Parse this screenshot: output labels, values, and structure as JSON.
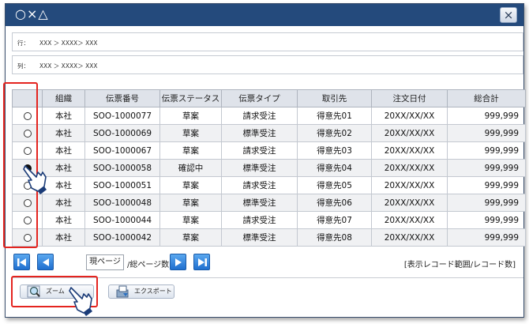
{
  "window": {
    "title": "○×△",
    "close_label": "×"
  },
  "breadcrumb_rows": [
    {
      "label": "行：",
      "path": "XXX ＞ XXXX＞ XXX"
    },
    {
      "label": "列：",
      "path": "XXX ＞ XXXX＞ XXX"
    }
  ],
  "table": {
    "columns": [
      "",
      "組織",
      "伝票番号",
      "伝票ステータス",
      "伝票タイプ",
      "取引先",
      "注文日付",
      "総合計"
    ],
    "rows": [
      {
        "selected": false,
        "org": "本社",
        "slip_no": "SOO-1000077",
        "status": "草案",
        "type": "請求受注",
        "partner": "得意先01",
        "date": "20XX/XX/XX",
        "total": "999,999"
      },
      {
        "selected": false,
        "org": "本社",
        "slip_no": "SOO-1000069",
        "status": "草案",
        "type": "標準受注",
        "partner": "得意先02",
        "date": "20XX/XX/XX",
        "total": "999,999"
      },
      {
        "selected": false,
        "org": "本社",
        "slip_no": "SOO-1000067",
        "status": "草案",
        "type": "請求受注",
        "partner": "得意先03",
        "date": "20XX/XX/XX",
        "total": "999,999"
      },
      {
        "selected": true,
        "org": "本社",
        "slip_no": "SOO-1000058",
        "status": "確認中",
        "type": "標準受注",
        "partner": "得意先04",
        "date": "20XX/XX/XX",
        "total": "999,999"
      },
      {
        "selected": false,
        "org": "本社",
        "slip_no": "SOO-1000051",
        "status": "草案",
        "type": "請求受注",
        "partner": "得意先05",
        "date": "20XX/XX/XX",
        "total": "999,999"
      },
      {
        "selected": false,
        "org": "本社",
        "slip_no": "SOO-1000048",
        "status": "草案",
        "type": "標準受注",
        "partner": "得意先06",
        "date": "20XX/XX/XX",
        "total": "999,999"
      },
      {
        "selected": false,
        "org": "本社",
        "slip_no": "SOO-1000044",
        "status": "草案",
        "type": "請求受注",
        "partner": "得意先07",
        "date": "20XX/XX/XX",
        "total": "999,999"
      },
      {
        "selected": false,
        "org": "本社",
        "slip_no": "SOO-1000042",
        "status": "草案",
        "type": "標準受注",
        "partner": "得意先08",
        "date": "20XX/XX/XX",
        "total": "999,999"
      }
    ]
  },
  "pager": {
    "current_page": "現ページ",
    "total_pages": "/総ページ数",
    "record_range": "[表示レコード範囲/レコード数]"
  },
  "actions": {
    "zoom_label": "ズーム",
    "export_label": "エクスポート"
  },
  "colors": {
    "titlebar": "#244a7c",
    "highlight": "#e4241f",
    "nav_button": "#1f6fcf"
  },
  "icons": [
    "first-page-icon",
    "prev-page-icon",
    "next-page-icon",
    "last-page-icon",
    "magnifier-icon",
    "export-icon",
    "pointing-hand-icon"
  ]
}
